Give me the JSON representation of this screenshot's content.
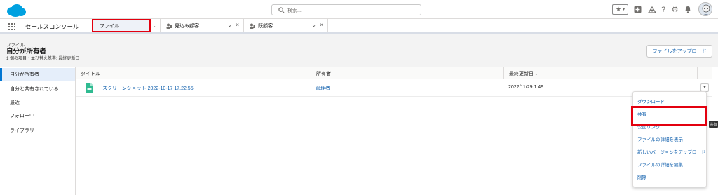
{
  "header": {
    "search_placeholder": "検索...",
    "icons": [
      "star-icon",
      "add-icon",
      "trailhead-icon",
      "help-icon",
      "setup-icon",
      "bell-icon",
      "avatar"
    ]
  },
  "nav": {
    "app_name": "セールスコンソール",
    "tabs": [
      {
        "label": "ファイル",
        "active": true
      },
      {
        "label": "見込み顧客"
      },
      {
        "label": "既顧客"
      }
    ]
  },
  "page": {
    "eyebrow": "ファイル",
    "title": "自分が所有者",
    "meta": "1 個の項目・並び替え基準: 最終更新日",
    "upload_label": "ファイルをアップロード"
  },
  "sidebar": {
    "items": [
      {
        "label": "自分が所有者",
        "active": true
      },
      {
        "label": "自分と共有されている"
      },
      {
        "label": "最近"
      },
      {
        "label": "フォロー中"
      },
      {
        "label": "ライブラリ"
      }
    ]
  },
  "table": {
    "columns": [
      "タイトル",
      "所有者",
      "最終更新日 ↓"
    ],
    "rows": [
      {
        "title": "スクリーンショット 2022-10-17 17.22.55",
        "owner": "管理者",
        "modified": "2022/11/29 1:49"
      }
    ]
  },
  "menu": {
    "items": [
      "ダウンロード",
      "共有",
      "公開リンク",
      "ファイルの詳細を表示",
      "新しいバージョンをアップロード",
      "ファイルの詳細を編集",
      "削除"
    ]
  },
  "tooltip": "共有",
  "colors": {
    "brand": "#00a1e0",
    "link": "#0b5cab",
    "highlight": "#e3000f"
  }
}
